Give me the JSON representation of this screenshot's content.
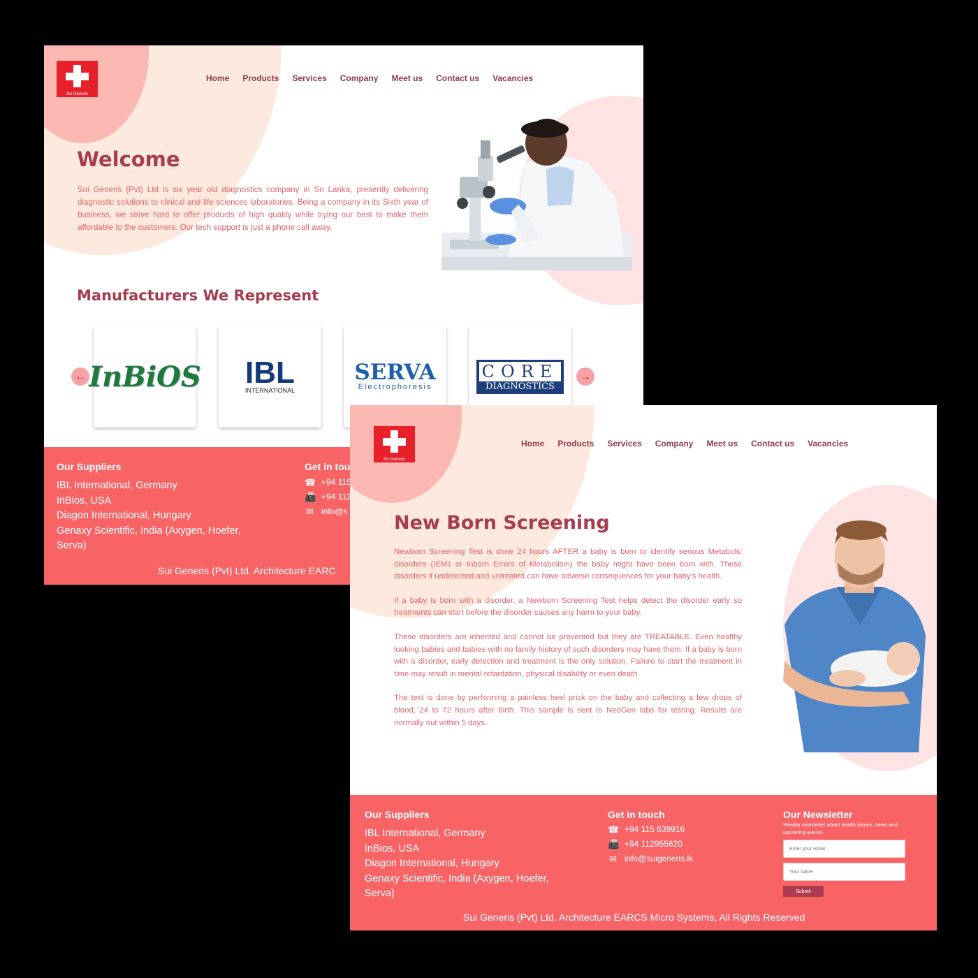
{
  "colors": {
    "accent": "#f86466",
    "heading": "#a53d4e",
    "nav": "#8e3a4a",
    "body_text": "#e2636b",
    "logo_red": "#e8202a"
  },
  "logo": {
    "text": "Sui Generis"
  },
  "nav": [
    "Home",
    "Products",
    "Services",
    "Company",
    "Meet us",
    "Contact us",
    "Vacancies"
  ],
  "page1": {
    "title": "Welcome",
    "text": "Sui Generis (Pvt) Ltd is six year old diagnostics company in Sri Lanka,  presently delivering diagnostic solutions to clinical and life sciences  laboratories. Being a company in its Sixth year of business, we strive  hard to offer products of high quality while trying our best to make  them affordable to the customers. Our tech support is just a phone call  away.",
    "image_desc": "scientist-with-microscope-image",
    "manufacturers_title": "Manufacturers We Represent",
    "manufacturers": [
      {
        "name": "InBiOS"
      },
      {
        "name": "IBL",
        "sub": "INTERNATIONAL"
      },
      {
        "name": "SERVA",
        "sub": "Electrophoresis"
      },
      {
        "name": "CORE",
        "sub": "DIAGNOSTICS"
      }
    ],
    "arrow_prev": "←",
    "arrow_next": "→"
  },
  "page2": {
    "title": "New Born Screening",
    "paragraphs": [
      "Newborn Screening Test is done 24 hours AFTER a  baby is born to identify serious Metabolic disorders (IEMs or Inborn  Errors of Metabolism) the baby might have been born  with.  These   disorders  if  undetected  and  untreated  can  have  adverse consequences for  your baby's health.",
      " If a baby is born with a disorder, a Newborn  Screening Test helps detect the disorder early so treatments can start  before the disorder causes any harm to your baby.",
      "These disorders are inherited and cannot be  prevented but they are TREATABLE. Even healthy looking babies and babies  with no family history of such disorders may have them. If a baby is  born with a disorder, early detection and treatment is the only solution. Failure to start the treatment in time may result in mental  retardation, physical disability or even death.",
      "The test is done by performing a painless heel  prick on the baby and collecting a few drops of blood, 24 to 72 hours  after birth. This sample is sent to NeoGen labs for testing. Results are  normally out within 5 days."
    ]
  },
  "footer": {
    "suppliers_title": "Our Suppliers",
    "suppliers": [
      "IBL International, Germany",
      "InBios, USA",
      "Diagon International, Hungary",
      "Genaxy Scientific, India (Axygen, Hoefer,",
      "Serva)"
    ],
    "contact_title": "Get in touch",
    "contact_title_cut": "Get in tou",
    "phone": "+94 115 639916",
    "fax": "+94 112955620",
    "email": "info@suigeneris.lk",
    "phone_cut": "+94 115",
    "fax_cut": "+94 112",
    "email_cut": "info@s",
    "newsletter_title": "Our Newsletter",
    "newsletter_desc": "Weekly newsletter about health issues, news and upcoming events",
    "email_placeholder": "Enter your email",
    "name_placeholder": "Your name",
    "submit": "Submit",
    "copyright": "Sui Generis (Pvt) Ltd. Architecture EARCS Micro Systems, All Rights Reserved",
    "copyright_cut": "Sui Generis (Pvt) Ltd. Architecture EARC"
  }
}
